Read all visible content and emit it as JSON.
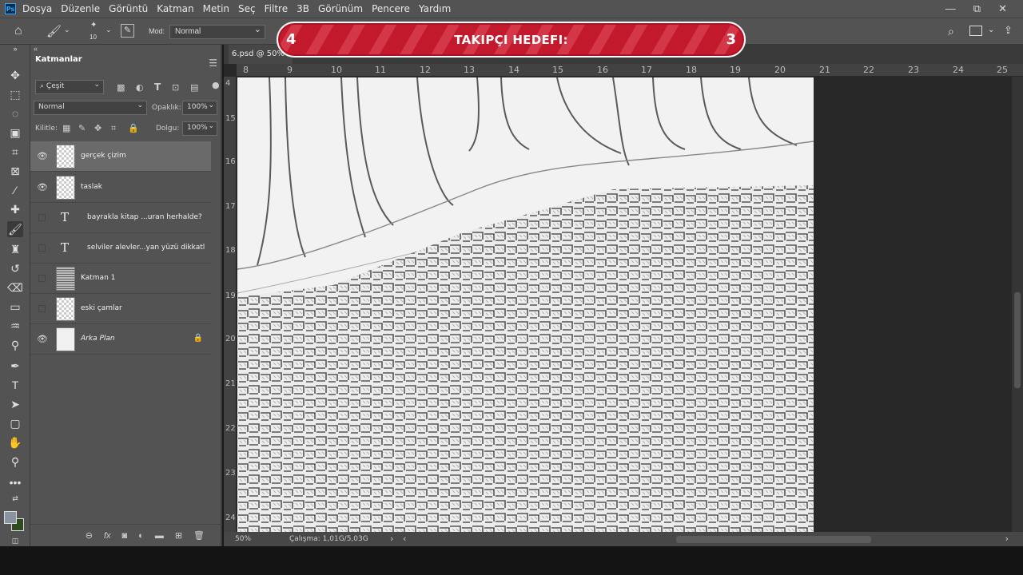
{
  "app": {
    "logo": "Ps"
  },
  "menu": [
    "Dosya",
    "Düzenle",
    "Görüntü",
    "Katman",
    "Metin",
    "Seç",
    "Filtre",
    "3B",
    "Görünüm",
    "Pencere",
    "Yardım"
  ],
  "window_controls": {
    "minimize": "—",
    "restore": "⧉",
    "close": "✕"
  },
  "options": {
    "brush_size": "10",
    "mode_label": "Mod:",
    "mode_value": "Normal"
  },
  "layers_panel": {
    "title": "Katmanlar",
    "filter": "Çeşit",
    "blend_mode": "Normal",
    "opacity_label": "Opaklık:",
    "opacity_value": "100%",
    "lock_label": "Kilitle:",
    "fill_label": "Dolgu:",
    "fill_value": "100%",
    "layers": [
      {
        "name": "gerçek çizim",
        "visible": true,
        "type": "pixel",
        "selected": true
      },
      {
        "name": "taslak",
        "visible": true,
        "type": "pixel",
        "selected": false
      },
      {
        "name": "bayrakla kitap ...uran herhalde?",
        "visible": false,
        "type": "text",
        "selected": false
      },
      {
        "name": "selviler alevler...yan yüzü dikkatl",
        "visible": false,
        "type": "text",
        "selected": false
      },
      {
        "name": "Katman 1",
        "visible": false,
        "type": "art",
        "selected": false
      },
      {
        "name": "eski çamlar",
        "visible": false,
        "type": "pixel",
        "selected": false
      },
      {
        "name": "Arka Plan",
        "visible": true,
        "type": "background",
        "selected": false,
        "locked": true
      }
    ]
  },
  "document": {
    "tab_label": "6.psd @ 50%",
    "zoom": "50%",
    "status": "Çalışma: 1,01G/5,03G",
    "ruler_top": [
      "8",
      "9",
      "10",
      "11",
      "12",
      "13",
      "14",
      "15",
      "16",
      "17",
      "18",
      "19",
      "20",
      "21",
      "22",
      "23",
      "24",
      "25"
    ],
    "ruler_left": [
      "4",
      "15",
      "16",
      "17",
      "18",
      "19",
      "20",
      "21",
      "22",
      "23",
      "24"
    ]
  },
  "banner": {
    "left_value": "4",
    "title": "TAKIPÇI HEDEFI:",
    "right_value": "3",
    "color_primary": "#c3192c",
    "color_stripe": "#d43848"
  }
}
